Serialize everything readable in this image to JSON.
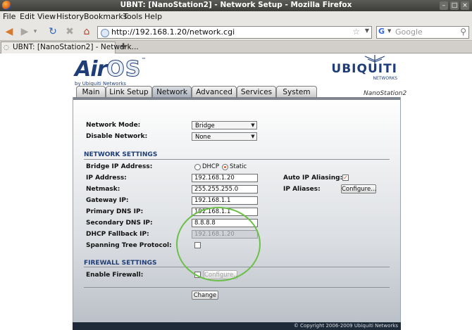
{
  "window": {
    "title": "UBNT: [NanoStation2] - Network Setup - Mozilla Firefox"
  },
  "menu": [
    "File",
    "Edit",
    "View",
    "History",
    "Bookmarks",
    "Tools",
    "Help"
  ],
  "nav": {
    "url": "http://192.168.1.20/network.cgi",
    "search_placeholder": "Google"
  },
  "tab": {
    "label": "UBNT: [NanoStation2] - Network..."
  },
  "header": {
    "logo_air": "Air",
    "logo_os": "OS",
    "logo_tm": "™",
    "logo_by": "by Ubiquiti Networks",
    "brand": "UBIQUITI",
    "brand_sub": "NETWORKS",
    "device": "NanoStation2"
  },
  "tabs": [
    "Main",
    "Link Setup",
    "Network",
    "Advanced",
    "Services",
    "System"
  ],
  "form": {
    "network_mode_label": "Network Mode:",
    "network_mode_value": "Bridge",
    "disable_network_label": "Disable Network:",
    "disable_network_value": "None",
    "network_settings_title": "NETWORK SETTINGS",
    "bridge_ip_label": "Bridge IP Address:",
    "dhcp_label": "DHCP",
    "static_label": "Static",
    "ip_label": "IP Address:",
    "ip_value": "192.168.1.20",
    "netmask_label": "Netmask:",
    "netmask_value": "255.255.255.0",
    "gateway_label": "Gateway IP:",
    "gateway_value": "192.168.1.1",
    "primary_dns_label": "Primary DNS IP:",
    "primary_dns_value": "192.168.1.1",
    "secondary_dns_label": "Secondary DNS IP:",
    "secondary_dns_value": "8.8.8.8",
    "dhcp_fallback_label": "DHCP Fallback IP:",
    "dhcp_fallback_value": "192.168.1.20",
    "stp_label": "Spanning Tree Protocol:",
    "auto_ip_label": "Auto IP Aliasing:",
    "ip_aliases_label": "IP Aliases:",
    "configure_label": "Configure...",
    "firewall_title": "FIREWALL SETTINGS",
    "enable_firewall_label": "Enable Firewall:",
    "firewall_configure_label": "Configure...",
    "change_label": "Change"
  },
  "footer": "© Copyright 2006-2009 Ubiquiti Networks",
  "colors": {
    "accent": "#1f3d78",
    "highlight_circle": "#6cc04a",
    "checkbox_mark": "#c4461b"
  }
}
